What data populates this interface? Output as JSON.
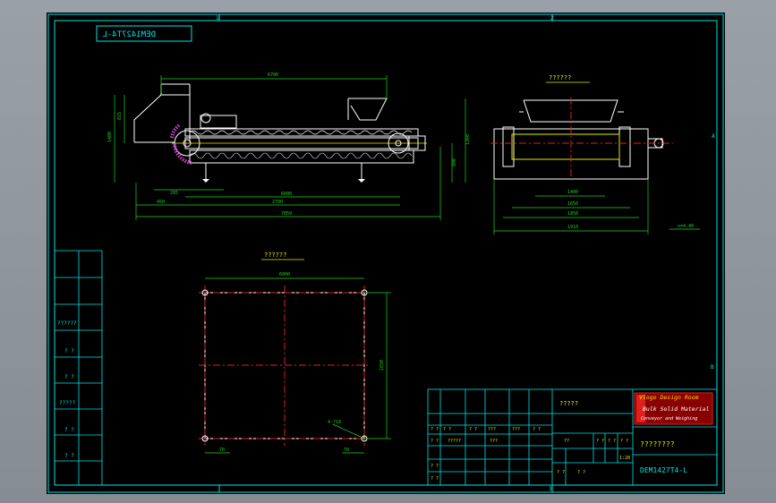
{
  "drawing": {
    "stamp_code": "DEM1427T4-L",
    "section_label": "??????",
    "plan_label": "??????",
    "grid_top": [
      "1",
      "2",
      "3"
    ],
    "grid_side": [
      "A",
      "B"
    ],
    "dimensions": {
      "top_span": "6700",
      "left_h1": "815",
      "left_h2": "1400",
      "right_h1": "1360",
      "right_h2": "800",
      "bottom_a": "265",
      "bottom_b": "6000",
      "bottom_c": "450",
      "bottom_d": "2700",
      "bottom_total": "7850",
      "side_w1": "1400",
      "side_w2": "1650",
      "side_w3": "1850",
      "side_w4": "1910",
      "side_note": "n=4.48",
      "plan_w": "6000",
      "plan_h": "1650",
      "plan_left": "70",
      "plan_right": "70",
      "plan_hole": "4-?18"
    }
  },
  "left_table": {
    "rows": [
      "??????",
      "? ?",
      "? ?",
      "?????",
      "? ?",
      "? ?"
    ]
  },
  "title_block": {
    "drawing_name": "?????",
    "company_logo_line1": "Vlogo Design Room",
    "company_logo_line2": "Bulk Solid Material",
    "company_logo_line3": "Conveyor and Weighing",
    "drawing_title": "????????",
    "drawing_number": "DEM1427T4-L",
    "cells": [
      "? ?",
      "? ?",
      "? ?",
      "???",
      "???",
      "? ?",
      "? ?",
      "?????",
      "???",
      "??",
      "? ?",
      "? ?",
      "? ?",
      "? ?",
      "? ?",
      "? ?",
      "? ?",
      "1:20"
    ]
  },
  "colors": {
    "frame": "#00e5e5",
    "object": "#ffffff",
    "dim": "#1fd41f",
    "center": "#e02020",
    "yellow": "#e8e800",
    "logo_bg": "#8a0000",
    "logo_fg": "#ffd400",
    "hatch": "#d040d0"
  }
}
